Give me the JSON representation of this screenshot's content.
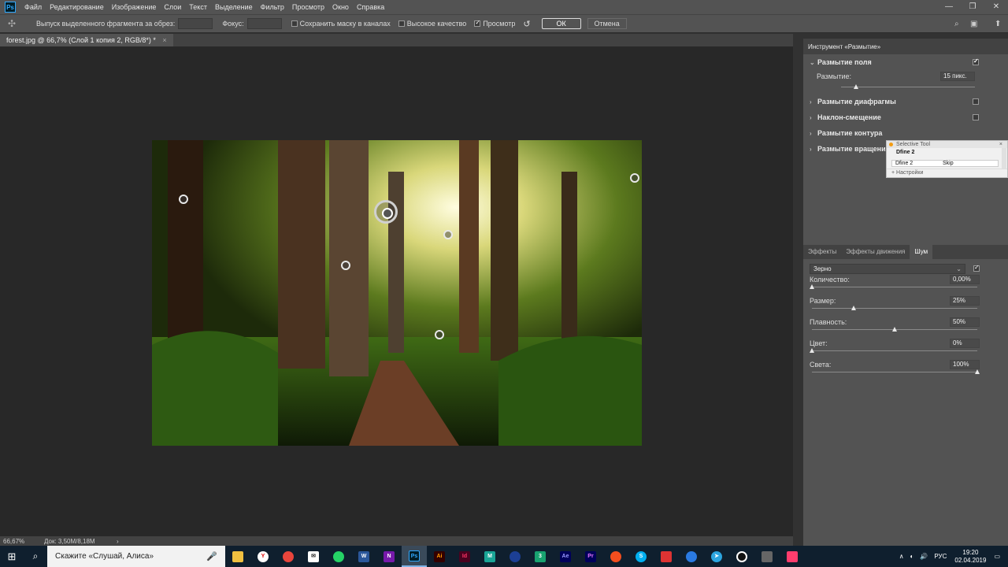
{
  "menubar": {
    "app_icon": "Ps",
    "items": [
      "Файл",
      "Редактирование",
      "Изображение",
      "Слои",
      "Текст",
      "Выделение",
      "Фильтр",
      "Просмотр",
      "Окно",
      "Справка"
    ]
  },
  "options": {
    "feather_label": "Выпуск выделенного фрагмента за обрез:",
    "focus_label": "Фокус:",
    "save_mask_label": "Сохранить маску в каналах",
    "high_quality_label": "Высокое качество",
    "preview_label": "Просмотр",
    "ok_label": "ОК",
    "cancel_label": "Отмена",
    "preview_checked": true
  },
  "document": {
    "tab_label": "forest.jpg @ 66,7% (Слой 1 копия 2, RGB/8*) *",
    "close_glyph": "×"
  },
  "status": {
    "zoom": "66,67%",
    "doc_info": "Док: 3,50M/8,18M",
    "arrow": "›"
  },
  "blur_tools": {
    "header": "Инструмент «Размытие»",
    "field_blur": {
      "label": "Размытие поля",
      "checked": true,
      "blur_label": "Размытие:",
      "blur_value": "15 пикс.",
      "slider_fraction": 0.14
    },
    "sections": [
      {
        "label": "Размытие диафрагмы",
        "checked": false
      },
      {
        "label": "Наклон-смещение",
        "checked": false
      },
      {
        "label": "Размытие контура",
        "checked": false
      },
      {
        "label": "Размытие вращения",
        "checked": false
      }
    ]
  },
  "popup": {
    "title": "Selective Tool",
    "item": "Dfine 2",
    "row_left": "Dfine 2",
    "row_right": "Skip",
    "footer": "Настройки"
  },
  "effects_tabs": [
    "Эффекты",
    "Эффекты движения",
    "Шум"
  ],
  "effects_active_tab": 2,
  "noise": {
    "type_label": "Зерно",
    "enabled": true,
    "params": [
      {
        "label": "Количество:",
        "value": "0,00%",
        "fraction": 0.0
      },
      {
        "label": "Размер:",
        "value": "25%",
        "fraction": 0.25
      },
      {
        "label": "Плавность:",
        "value": "50%",
        "fraction": 0.5
      },
      {
        "label": "Цвет:",
        "value": "0%",
        "fraction": 0.0
      },
      {
        "label": "Света:",
        "value": "100%",
        "fraction": 1.0
      }
    ]
  },
  "taskbar": {
    "search_placeholder": "Скажите «Слушай, Алиса»",
    "lang": "РУС",
    "time": "19:20",
    "date": "02.04.2019"
  }
}
